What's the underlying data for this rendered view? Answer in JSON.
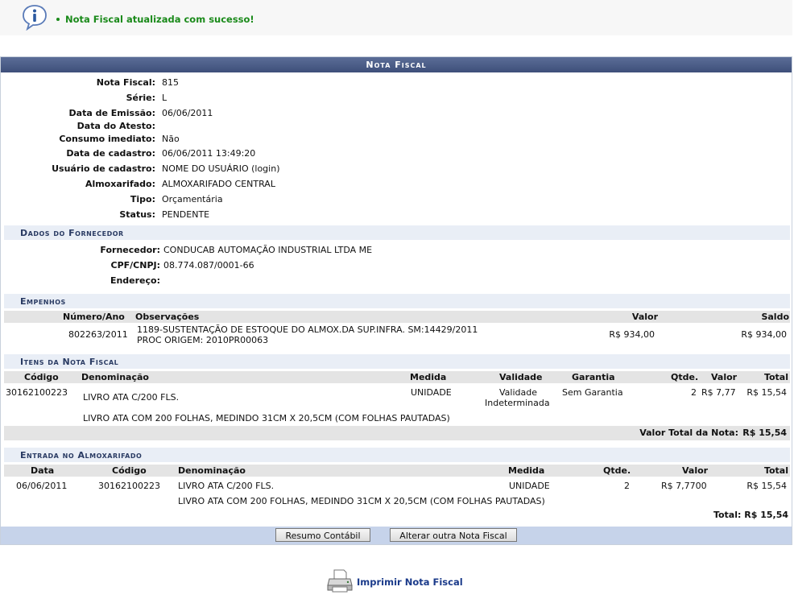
{
  "message": {
    "text": "Nota Fiscal atualizada com sucesso!"
  },
  "panel": {
    "title": "Nota Fiscal"
  },
  "nota": {
    "fields": [
      {
        "label": "Nota Fiscal:",
        "value": "815"
      },
      {
        "label": "Série:",
        "value": "L"
      },
      {
        "label": "Data de Emissão:",
        "value": "06/06/2011"
      },
      {
        "label": "Data do Atesto:",
        "value": ""
      },
      {
        "label": "Consumo imediato:",
        "value": "Não"
      },
      {
        "label": "Data de cadastro:",
        "value": "06/06/2011 13:49:20"
      },
      {
        "label": "Usuário de cadastro:",
        "value": "NOME DO USUÁRIO (login)"
      },
      {
        "label": "Almoxarifado:",
        "value": "ALMOXARIFADO CENTRAL"
      },
      {
        "label": "Tipo:",
        "value": "Orçamentária"
      },
      {
        "label": "Status:",
        "value": "PENDENTE"
      }
    ]
  },
  "fornecedor": {
    "section_title": "Dados do Fornecedor",
    "fields": [
      {
        "label": "Fornecedor:",
        "value": "CONDUCAB AUTOMAÇÃO INDUSTRIAL LTDA ME"
      },
      {
        "label": "CPF/CNPJ:",
        "value": "08.774.087/0001-66"
      },
      {
        "label": "Endereço:",
        "value": ""
      }
    ]
  },
  "empenhos": {
    "section_title": "Empenhos",
    "headers": {
      "numero": "Número/Ano",
      "obs": "Observações",
      "valor": "Valor",
      "saldo": "Saldo"
    },
    "rows": [
      {
        "numero": "802263/2011",
        "obs1": "1189-SUSTENTAÇÃO DE ESTOQUE DO ALMOX.DA SUP.INFRA. SM:14429/2011",
        "obs2": "PROC ORIGEM: 2010PR00063",
        "valor": "R$ 934,00",
        "saldo": "R$ 934,00"
      }
    ]
  },
  "itens": {
    "section_title": "Itens da Nota Fiscal",
    "headers": {
      "codigo": "Código",
      "denominacao": "Denominação",
      "medida": "Medida",
      "validade": "Validade",
      "garantia": "Garantia",
      "qtde": "Qtde.",
      "valor": "Valor",
      "total": "Total"
    },
    "rows": [
      {
        "codigo": "30162100223",
        "denominacao": "LIVRO ATA C/200 FLS.",
        "medida": "UNIDADE",
        "validade1": "Validade",
        "validade2": "Indeterminada",
        "garantia": "Sem Garantia",
        "qtde": "2",
        "valor": "R$ 7,77",
        "total": "R$ 15,54",
        "descricao": "LIVRO ATA COM 200 FOLHAS, MEDINDO 31CM X 20,5CM (COM FOLHAS PAUTADAS)"
      }
    ],
    "total_label": "Valor Total da Nota:",
    "total_value": "R$ 15,54"
  },
  "entrada": {
    "section_title": "Entrada no Almoxarifado",
    "headers": {
      "data": "Data",
      "codigo": "Código",
      "denominacao": "Denominação",
      "medida": "Medida",
      "qtde": "Qtde.",
      "valor": "Valor",
      "total": "Total"
    },
    "rows": [
      {
        "data": "06/06/2011",
        "codigo": "30162100223",
        "denominacao": "LIVRO ATA C/200 FLS.",
        "medida": "UNIDADE",
        "qtde": "2",
        "valor": "R$ 7,7700",
        "total": "R$ 15,54",
        "descricao": "LIVRO ATA COM 200 FOLHAS, MEDINDO 31CM X 20,5CM (COM FOLHAS PAUTADAS)"
      }
    ],
    "total_label": "Total:",
    "total_value": "R$ 15,54"
  },
  "buttons": {
    "resumo": "Resumo Contábil",
    "alterar": "Alterar outra Nota Fiscal"
  },
  "print": {
    "label": "Imprimir Nota Fiscal"
  },
  "icons": {
    "info": "info-icon",
    "printer": "printer-icon"
  }
}
